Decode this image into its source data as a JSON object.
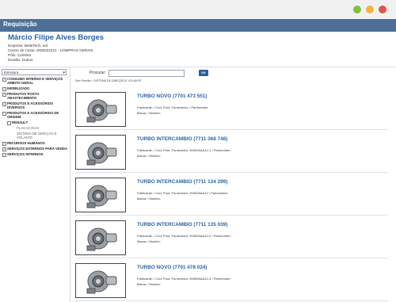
{
  "window": {
    "title": "Requisição"
  },
  "user": {
    "name": "Márcio Filipe Alves Borges",
    "empresa": "Empresa: BelteTech, Ltd",
    "centro": "Centro de Custo: 2000222221 - COMPRAS GERAIS",
    "polo": "Pólo: Coimbra",
    "divisao": "Divisão: Outros"
  },
  "sidebar": {
    "select_value": "Estrutura",
    "items": [
      {
        "label": "CONSUMO INTERNO E SERVIÇOS AMBITO GERAL",
        "level": 0,
        "marker": "+"
      },
      {
        "label": "IMOBILIZADO",
        "level": 0,
        "marker": "+"
      },
      {
        "label": "PRODUTOS POSTO ABASTECIMENTO",
        "level": 0,
        "marker": "+"
      },
      {
        "label": "PRODUTOS E ACESSÓRIOS DIVERSOS",
        "level": 0,
        "marker": "+"
      },
      {
        "label": "PRODUTOS E ACESSÓRIOS DE ORIGEM",
        "level": 0,
        "marker": "-"
      },
      {
        "label": "RENAULT",
        "level": 1,
        "marker": "-"
      },
      {
        "label": "PLACAS DIAS",
        "level": 2,
        "marker": ""
      },
      {
        "label": "SISTEMA DE DIREÇÃO E VOLANTE",
        "level": 2,
        "marker": ""
      },
      {
        "label": "RECURSOS HUMANOS",
        "level": 0,
        "marker": "+"
      },
      {
        "label": "SERVIÇOS EXTERNOS PARA VENDA",
        "level": 0,
        "marker": "+"
      },
      {
        "label": "SERVIÇOS INTERNOS",
        "level": 0,
        "marker": "+"
      }
    ]
  },
  "search": {
    "label": "Procurar:",
    "value": "",
    "button": "OK"
  },
  "breadcrumb": "Sub-Família > SISTEMA DE DIREÇÃO E VOLANTE",
  "products": [
    {
      "title": "TURBO NOVO (7701 473 551)",
      "line1": "Fabricante: / Cód. Prod. Fornecedor: / Partnumber:",
      "line2": "Marca: / Modelo:"
    },
    {
      "title": "TURBO INTERCAMBIO (7711 368 748)",
      "line1": "Fabricante: / Cód. Prod. Fornecedor: 90000AAA12-1 / Partnumber:",
      "line2": "Marca: / Modelo:"
    },
    {
      "title": "TURBO INTERCAMBIO (7711 134 299)",
      "line1": "Fabricante: / Cód. Prod. Fornecedor: 90000AAA12 / Partnumber:",
      "line2": "Marca: / Modelo:"
    },
    {
      "title": "TURBO INTERCAMBIO (7711 135 039)",
      "line1": "Fabricante: / Cód. Prod. Fornecedor: 90000AAA12-2 / Partnumber:",
      "line2": "Marca: / Modelo:"
    },
    {
      "title": "TURBO NOVO (7701 478 024)",
      "line1": "Fabricante: / Cód. Prod. Fornecedor: 90000AAA12-3 / Partnumber:",
      "line2": "Marca: / Modelo:"
    }
  ],
  "colors": {
    "titlebar": "#4e6f96",
    "link": "#2a63a6",
    "button": "#2a5e99"
  }
}
